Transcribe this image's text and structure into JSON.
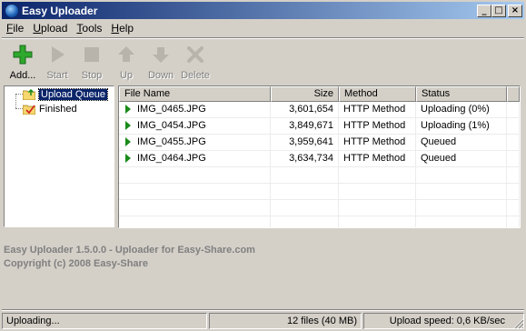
{
  "window": {
    "title": "Easy Uploader",
    "controls": {
      "minimize": "_",
      "maximize": "□",
      "close": "×"
    }
  },
  "menu": [
    {
      "label": "File",
      "accel": "F"
    },
    {
      "label": "Upload",
      "accel": "U"
    },
    {
      "label": "Tools",
      "accel": "T"
    },
    {
      "label": "Help",
      "accel": "H"
    }
  ],
  "toolbar": [
    {
      "label": "Add...",
      "icon": "add-icon",
      "enabled": true
    },
    {
      "label": "Start",
      "icon": "start-icon",
      "enabled": false
    },
    {
      "label": "Stop",
      "icon": "stop-icon",
      "enabled": false
    },
    {
      "label": "Up",
      "icon": "up-arrow-icon",
      "enabled": false
    },
    {
      "label": "Down",
      "icon": "down-arrow-icon",
      "enabled": false
    },
    {
      "label": "Delete",
      "icon": "delete-icon",
      "enabled": false
    }
  ],
  "tree": [
    {
      "label": "Upload Queue",
      "selected": true,
      "icon": "upload-queue-icon"
    },
    {
      "label": "Finished",
      "selected": false,
      "icon": "finished-icon"
    }
  ],
  "list": {
    "columns": [
      "File Name",
      "Size",
      "Method",
      "Status"
    ],
    "rows": [
      {
        "name": "IMG_0465.JPG",
        "size": "3,601,654",
        "method": "HTTP Method",
        "status": "Uploading (0%)"
      },
      {
        "name": "IMG_0454.JPG",
        "size": "3,849,671",
        "method": "HTTP Method",
        "status": "Uploading (1%)"
      },
      {
        "name": "IMG_0455.JPG",
        "size": "3,959,641",
        "method": "HTTP Method",
        "status": "Queued"
      },
      {
        "name": "IMG_0464.JPG",
        "size": "3,634,734",
        "method": "HTTP Method",
        "status": "Queued"
      }
    ]
  },
  "info": {
    "line1": "Easy Uploader 1.5.0.0 - Uploader for Easy-Share.com",
    "line2": "Copyright (c) 2008 Easy-Share"
  },
  "status": {
    "state": "Uploading...",
    "files": "12 files (40 MB)",
    "speed": "Upload speed: 0,6 KB/sec"
  },
  "colors": {
    "titlebar_start": "#0a246a",
    "titlebar_end": "#a6caf0",
    "accent_green": "#1a8a1a",
    "face": "#d4d0c8"
  }
}
